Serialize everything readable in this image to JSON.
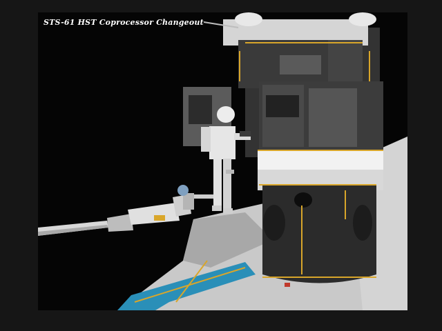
{
  "caption": "STS-61 HST Coprocessor Changeout",
  "colors": {
    "background": "#050505",
    "telescope_body": "#2b2b2b",
    "telescope_band": "#f2f2f2",
    "handrail": "#d9a62a",
    "payload_bay": "#c9c9c9",
    "bay_trim": "#2a8fb8"
  }
}
